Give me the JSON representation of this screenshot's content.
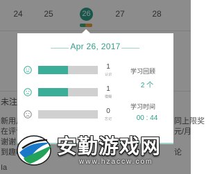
{
  "calendar": {
    "days": [
      "24",
      "25",
      "26",
      "27",
      "28"
    ],
    "selected_day": "26"
  },
  "background": {
    "left_fragments": [
      "未注册",
      "新用户",
      "在评论",
      "谢谢！",
      "到趣味",
      "Ia"
    ],
    "right_fragments": [
      "同上限奖",
      "元/月",
      "论"
    ]
  },
  "popup": {
    "date": "Apr 26, 2017",
    "rows": [
      {
        "face": "smile-face-icon",
        "fill": 0.5,
        "count": "1",
        "label": "认识"
      },
      {
        "face": "neutral-face-icon",
        "fill": 0.5,
        "count": "1",
        "label": "模糊"
      },
      {
        "face": "sad-face-icon",
        "fill": 0.0,
        "count": "0",
        "label": "忘记"
      }
    ],
    "review_title": "学习回顾",
    "review_value": "2 个",
    "time_title": "学习时间",
    "time_value": "00 : 44"
  },
  "watermark": {
    "text": "安勤游戏网",
    "url": "www.hzaccw.com"
  },
  "colors": {
    "accent": "#2e9e8a",
    "bar_fill": "#3aae98",
    "bar_track": "#d0d0d0",
    "orange": "#e5a147"
  }
}
